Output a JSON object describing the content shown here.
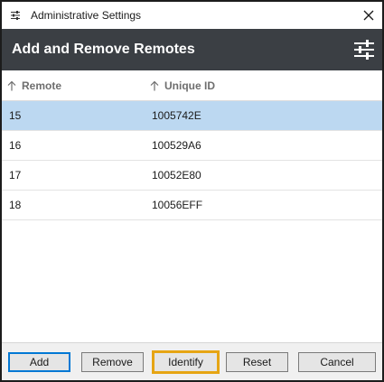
{
  "window": {
    "title": "Administrative Settings",
    "title_icon": "sliders-icon",
    "close_icon": "close-icon"
  },
  "header": {
    "title": "Add and Remove Remotes",
    "settings_icon": "sliders-icon",
    "background": "#3b3f44"
  },
  "table": {
    "columns": [
      {
        "label": "Remote",
        "sort_icon": "arrow-up-icon"
      },
      {
        "label": "Unique ID",
        "sort_icon": "arrow-up-icon"
      }
    ],
    "rows": [
      {
        "remote": "15",
        "unique_id": "1005742E",
        "selected": true
      },
      {
        "remote": "16",
        "unique_id": "100529A6",
        "selected": false
      },
      {
        "remote": "17",
        "unique_id": "10052E80",
        "selected": false
      },
      {
        "remote": "18",
        "unique_id": "10056EFF",
        "selected": false
      }
    ],
    "selected_color": "#bcd8f1"
  },
  "footer": {
    "buttons": {
      "add": "Add",
      "remove": "Remove",
      "identify": "Identify",
      "reset": "Reset",
      "cancel": "Cancel"
    },
    "focus_color": "#e6a514"
  }
}
